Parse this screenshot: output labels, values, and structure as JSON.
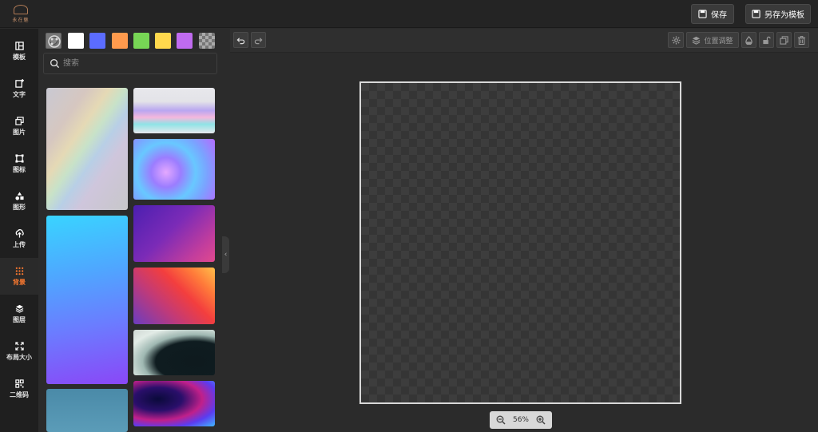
{
  "app": {
    "logo_text": "永在魅"
  },
  "header": {
    "save_label": "保存",
    "save_template_label": "另存为模板"
  },
  "sidebar": {
    "items": [
      {
        "label": "模板",
        "icon": "template-icon"
      },
      {
        "label": "文字",
        "icon": "text-icon"
      },
      {
        "label": "图片",
        "icon": "image-icon"
      },
      {
        "label": "图标",
        "icon": "icon-icon"
      },
      {
        "label": "图形",
        "icon": "shape-icon"
      },
      {
        "label": "上传",
        "icon": "upload-icon"
      },
      {
        "label": "背景",
        "icon": "background-icon",
        "active": true
      },
      {
        "label": "图层",
        "icon": "layers-icon"
      },
      {
        "label": "布局大小",
        "icon": "resize-icon"
      },
      {
        "label": "二维码",
        "icon": "qrcode-icon"
      }
    ]
  },
  "panel": {
    "swatches": [
      {
        "name": "custom-color-picker",
        "color": "checker"
      },
      {
        "name": "white",
        "color": "#ffffff"
      },
      {
        "name": "blue",
        "color": "#5b6cff"
      },
      {
        "name": "orange",
        "color": "#ff9a4d"
      },
      {
        "name": "green",
        "color": "#77d655"
      },
      {
        "name": "yellow",
        "color": "#ffd84d"
      },
      {
        "name": "purple",
        "color": "#c06bf0"
      },
      {
        "name": "transparent",
        "color": "transparent-checker"
      }
    ],
    "search_placeholder": "搜索"
  },
  "toolbar": {
    "position_adjust_label": "位置调整"
  },
  "canvas": {
    "zoom_level": "56%"
  },
  "colors": {
    "accent": "#ff7a2f",
    "sidebar_bg": "#1f1f1f",
    "canvas_bg": "#2b2b2b"
  }
}
